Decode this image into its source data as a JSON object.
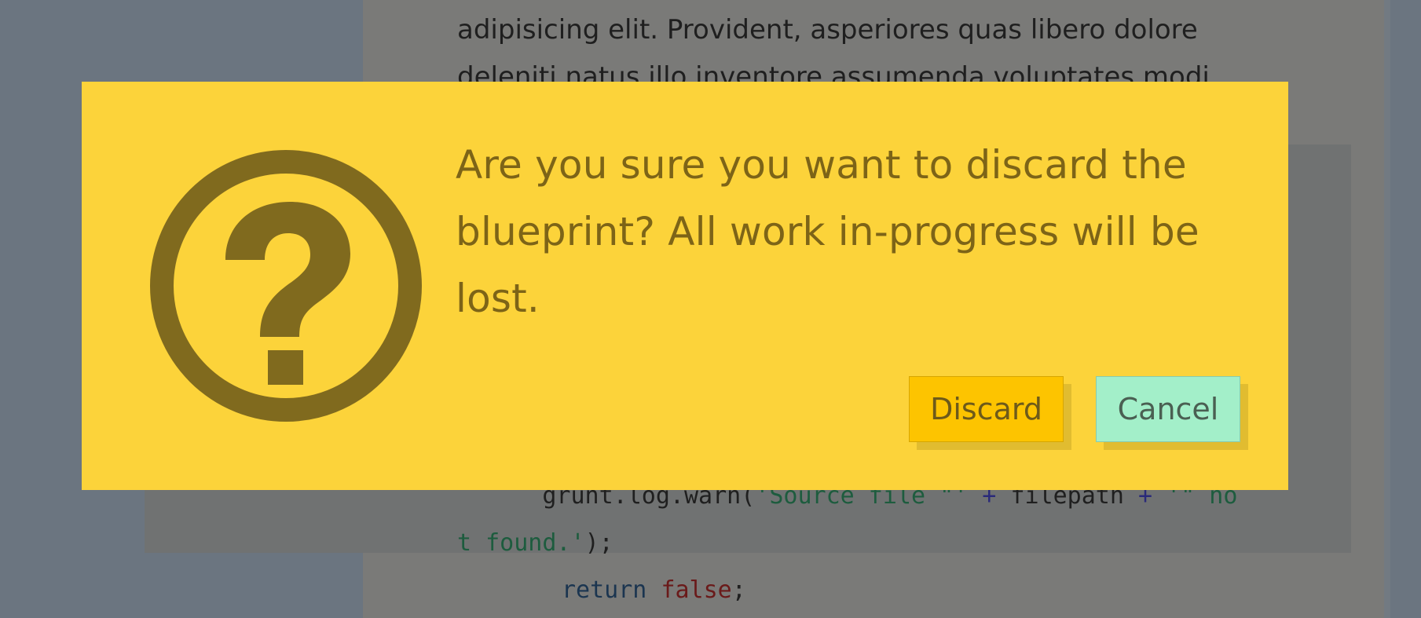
{
  "background": {
    "prose_lines": [
      "adipisicing elit. Provident, asperiores quas libero dolore",
      "deleniti natus illo inventore assumenda voluptates modi"
    ],
    "code": {
      "line1_indent": "      ",
      "line1_a": "grunt.log.warn(",
      "line1_str1": "'Source file \"'",
      "line1_op1": " + ",
      "line1_var": "filepath",
      "line1_op2": " + ",
      "line1_str2": "'\" no",
      "line2_str": "t found.'",
      "line2_end": ");",
      "line3_kw": "return",
      "line3_lit": "false",
      "line3_end": ";"
    }
  },
  "dialog": {
    "icon": "question-circle-icon",
    "message_lines": [
      "Are you sure you want to discard the",
      "blueprint? All work in-progress will be",
      "lost."
    ],
    "discard_label": "Discard",
    "cancel_label": "Cancel",
    "colors": {
      "dialog_bg": "#fcd33a",
      "icon": "#806a1e",
      "discard_bg": "#fdc400",
      "cancel_bg": "#a3efc9"
    }
  }
}
